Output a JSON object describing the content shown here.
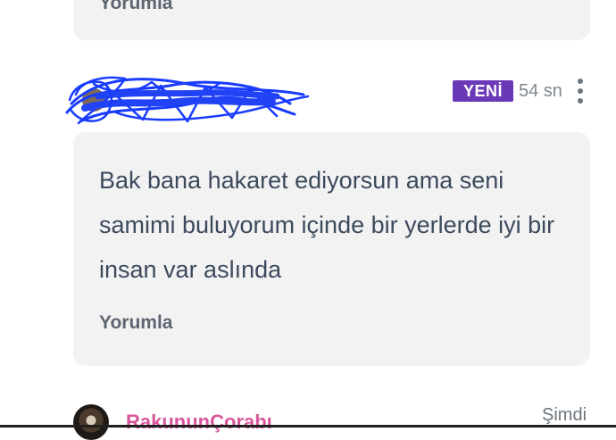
{
  "previous_comment": {
    "reply_label": "Yorumla"
  },
  "comment": {
    "badge": "YENİ",
    "timestamp": "54 sn",
    "text": "Bak bana hakaret ediyorsun ama seni samimi buluyorum içinde bir yerlerde iyi bir insan var aslında",
    "reply_label": "Yorumla",
    "menu_icon": "more-vert-icon",
    "username_scribble_color": "#1a3cff"
  },
  "next_comment": {
    "username": "RakununÇorabı",
    "timestamp": "Şimdi"
  },
  "colors": {
    "badge_bg": "#6a39b8",
    "username_pink": "#d9559a",
    "card_bg": "#f2f2f3"
  }
}
